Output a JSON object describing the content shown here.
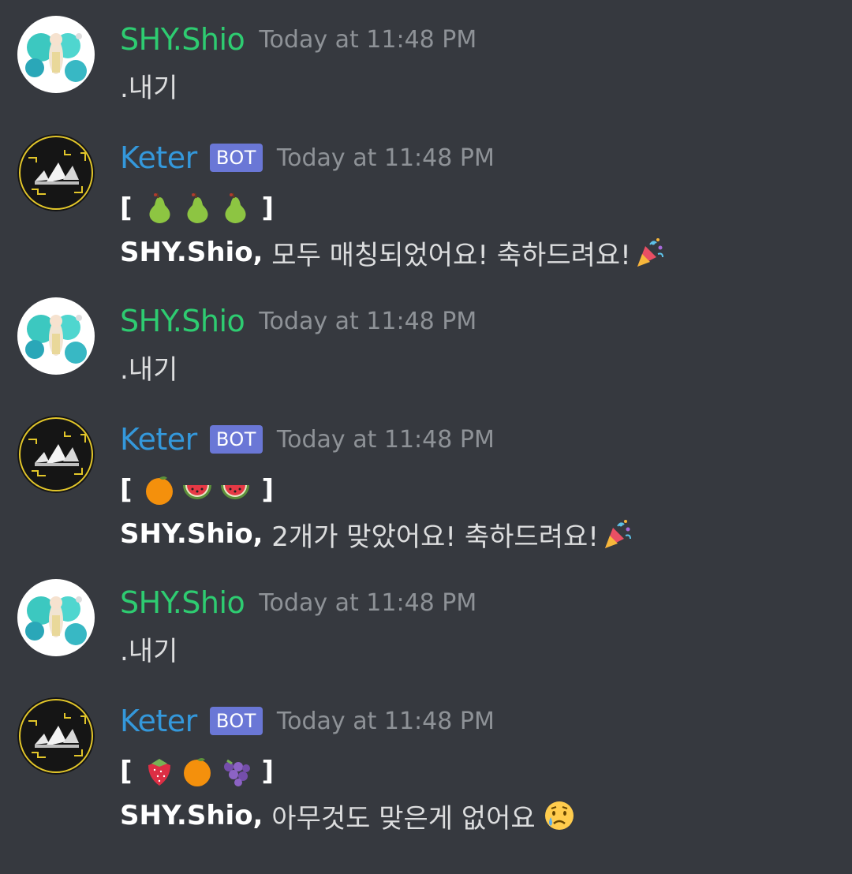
{
  "messages": [
    {
      "author": "SHY.Shio",
      "avatar_icon": "anime-girl-avatar",
      "timestamp": "Today at 11:48 PM",
      "text": ".내기"
    },
    {
      "author": "Keter",
      "badge": "BOT",
      "avatar_icon": "keter-bot-avatar",
      "timestamp": "Today at 11:48 PM",
      "result": {
        "open": "[",
        "close": "]",
        "slots": [
          "pear-emoji",
          "pear-emoji",
          "pear-emoji"
        ]
      },
      "mention": "SHY.Shio,",
      "text": " 모두 매칭되었어요! 축하드려요!",
      "trailing_emoji": "party-popper-emoji"
    },
    {
      "author": "SHY.Shio",
      "avatar_icon": "anime-girl-avatar",
      "timestamp": "Today at 11:48 PM",
      "text": ".내기"
    },
    {
      "author": "Keter",
      "badge": "BOT",
      "avatar_icon": "keter-bot-avatar",
      "timestamp": "Today at 11:48 PM",
      "result": {
        "open": "[",
        "close": "]",
        "slots": [
          "tangerine-emoji",
          "watermelon-emoji",
          "watermelon-emoji"
        ]
      },
      "mention": "SHY.Shio,",
      "text": " 2개가 맞았어요! 축하드려요!",
      "trailing_emoji": "party-popper-emoji"
    },
    {
      "author": "SHY.Shio",
      "avatar_icon": "anime-girl-avatar",
      "timestamp": "Today at 11:48 PM",
      "text": ".내기"
    },
    {
      "author": "Keter",
      "badge": "BOT",
      "avatar_icon": "keter-bot-avatar",
      "timestamp": "Today at 11:48 PM",
      "result": {
        "open": "[",
        "close": "]",
        "slots": [
          "strawberry-emoji",
          "tangerine-emoji",
          "grapes-emoji"
        ]
      },
      "mention": "SHY.Shio,",
      "text": " 아무것도 맞은게 없어요",
      "trailing_emoji": "crying-face-emoji"
    }
  ],
  "colors": {
    "background": "#36393f",
    "user_name": "#2ecc71",
    "bot_name": "#3498db",
    "bot_badge": "#6a77d6",
    "timestamp": "#8e9297",
    "text": "#dcddde"
  }
}
